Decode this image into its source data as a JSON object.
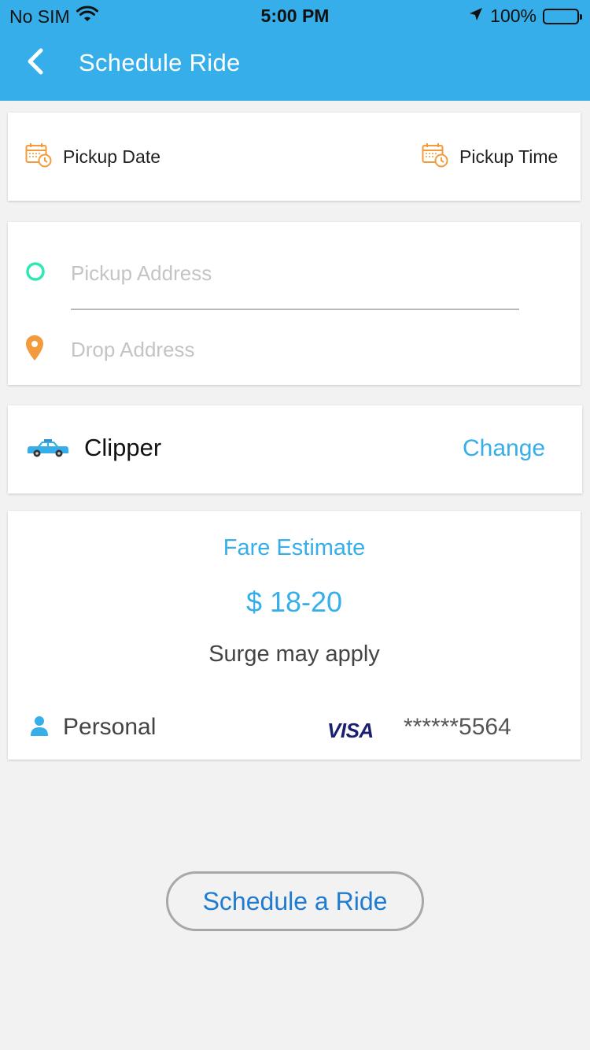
{
  "status_bar": {
    "carrier": "No SIM",
    "time": "5:00 PM",
    "battery": "100%"
  },
  "nav": {
    "title": "Schedule Ride",
    "back_icon": "chevron-left-icon"
  },
  "schedule": {
    "pickup_date_label": "Pickup Date",
    "pickup_time_label": "Pickup Time",
    "icon": "calendar-clock-icon"
  },
  "address": {
    "pickup_placeholder": "Pickup Address",
    "drop_placeholder": "Drop Address"
  },
  "ride": {
    "name": "Clipper",
    "change_label": "Change",
    "icon": "taxi-icon"
  },
  "fare": {
    "title": "Fare Estimate",
    "value": "$ 18-20",
    "note": "Surge may apply"
  },
  "payment": {
    "profile": "Personal",
    "card_brand": "VISA",
    "card_number": "******5564"
  },
  "action": {
    "schedule_label": "Schedule a Ride"
  },
  "colors": {
    "accent": "#35aeea",
    "orange": "#f39a3c",
    "green": "#2ee8b4",
    "button_text": "#1f7bd1"
  }
}
